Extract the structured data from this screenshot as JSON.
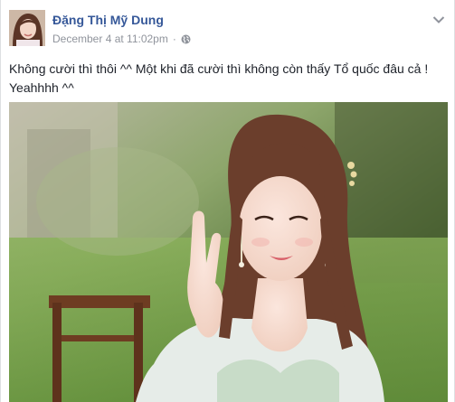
{
  "post": {
    "author_name": "Đặng Thị Mỹ Dung",
    "timestamp": "December 4 at 11:02pm",
    "separator": "·",
    "privacy_icon": "globe-icon",
    "options_icon": "chevron-down-icon",
    "text": "Không cười thì thôi ^^ Một khi đã cười thì không còn thấy Tổ quốc đâu cả ! Yeahhhh ^^"
  },
  "colors": {
    "author_link": "#365899",
    "meta_text": "#90949c",
    "body_text": "#1d2129"
  }
}
